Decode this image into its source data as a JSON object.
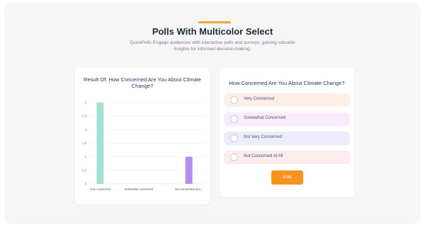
{
  "header": {
    "title": "Polls With Multicolor Select",
    "subtitle": "QuickPolls Engage audiences with interactive polls and surveys, gaining valuable insights for informed decision-making."
  },
  "results": {
    "title": "Result Of: How Concerned Are You About Climate Change?"
  },
  "chart_data": {
    "type": "bar",
    "title": "Result Of: How Concerned Are You About Climate Change?",
    "categories": [
      "Very concerned",
      "Somewhat concerned",
      "Not concerned at a..."
    ],
    "values": [
      3,
      0,
      1
    ],
    "colors": [
      "#a5dfd2",
      "#d9b8f5",
      "#b48cf2"
    ],
    "ylim": [
      0,
      3
    ],
    "yticks": [
      "0",
      "0.5",
      "1",
      "1.5",
      "2",
      "2.5",
      "3"
    ],
    "grid": true,
    "xlabel": "",
    "ylabel": ""
  },
  "poll": {
    "question": "How Concerned Are You About Climate Change?",
    "options": [
      {
        "label": "Very Concerned",
        "color": "#fdeee8"
      },
      {
        "label": "Somewhat Concerned",
        "color": "#f8ebfb"
      },
      {
        "label": "Not Very Concerned",
        "color": "#ecedfb"
      },
      {
        "label": "Not Concerned At All",
        "color": "#fdecec"
      }
    ],
    "vote_label": "Vote",
    "vote_color": "#f7941d"
  }
}
